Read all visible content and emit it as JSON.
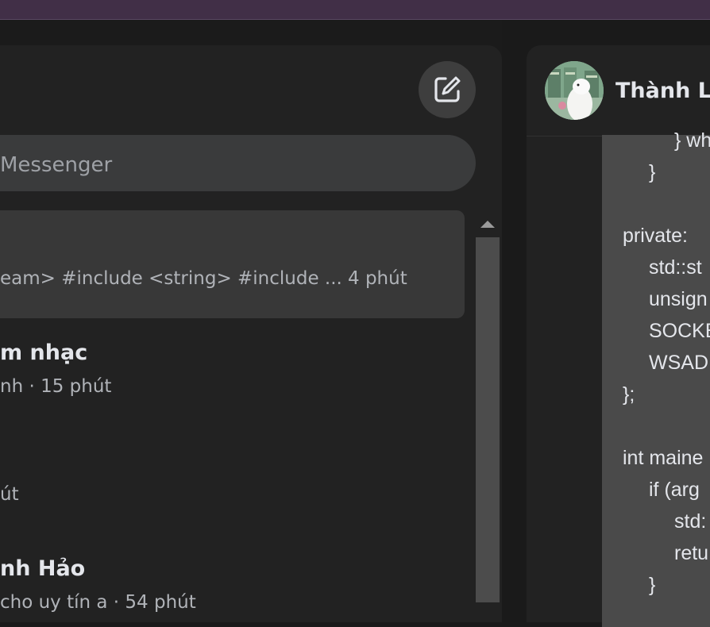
{
  "search": {
    "placeholder": "Messenger"
  },
  "conversations": [
    {
      "preview": "eam> #include <string> #include ...",
      "time": "4 phút"
    },
    {
      "name": "m nhạc",
      "meta": "nh · 15 phút"
    },
    {
      "meta": "út"
    },
    {
      "name": "nh Hảo",
      "meta": "cho uy tín a · 54 phút"
    }
  ],
  "chat": {
    "contact_name": "Thành Lu",
    "code_lines": [
      "} wh",
      "}",
      "",
      "private:",
      "std::st",
      "unsign",
      "SOCKE",
      "WSAD",
      "};",
      "",
      "int maine",
      "if (arg",
      "std:",
      "retu",
      "}"
    ]
  },
  "icons": {
    "compose": "compose-edit-icon"
  },
  "colors": {
    "titlebar": "#412f47",
    "panel": "#222222",
    "active_conversation": "#383838",
    "search_field": "#3a3b3c",
    "message_bubble": "#4a4a4a"
  }
}
